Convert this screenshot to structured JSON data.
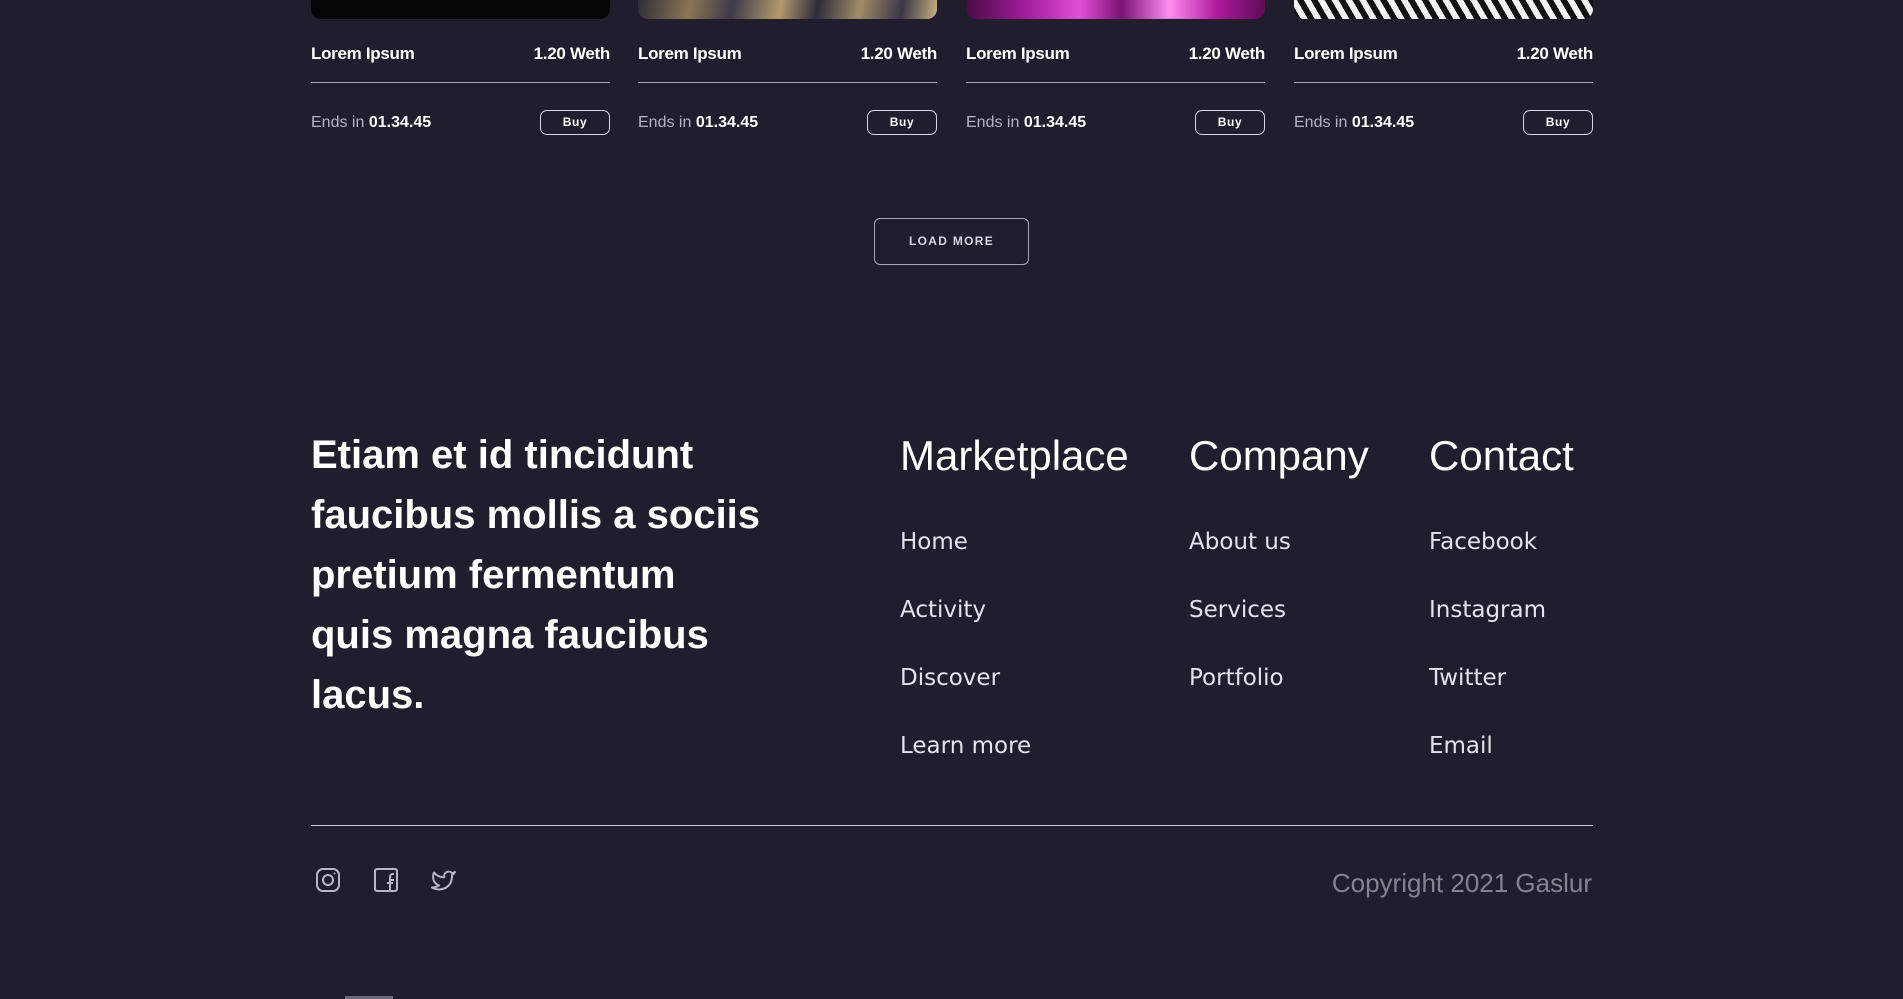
{
  "cards": [
    {
      "title": "Lorem Ipsum",
      "price": "1.20 Weth",
      "ends_label": "Ends in",
      "ends_time": "01.34.45",
      "buy_label": "Buy"
    },
    {
      "title": "Lorem Ipsum",
      "price": "1.20 Weth",
      "ends_label": "Ends in",
      "ends_time": "01.34.45",
      "buy_label": "Buy"
    },
    {
      "title": "Lorem Ipsum",
      "price": "1.20 Weth",
      "ends_label": "Ends in",
      "ends_time": "01.34.45",
      "buy_label": "Buy"
    },
    {
      "title": "Lorem Ipsum",
      "price": "1.20 Weth",
      "ends_label": "Ends in",
      "ends_time": "01.34.45",
      "buy_label": "Buy"
    }
  ],
  "load_more_label": "LOAD MORE",
  "footer": {
    "tagline": "Etiam et id tincidunt faucibus mollis a sociis pretium fermentum quis magna faucibus lacus.",
    "columns": {
      "marketplace": {
        "title": "Marketplace",
        "links": [
          "Home",
          "Activity",
          "Discover",
          "Learn more"
        ]
      },
      "company": {
        "title": "Company",
        "links": [
          "About us",
          "Services",
          "Portfolio"
        ]
      },
      "contact": {
        "title": "Contact",
        "links": [
          "Facebook",
          "Instagram",
          "Twitter",
          "Email"
        ]
      }
    },
    "socials": [
      "instagram-icon",
      "facebook-icon",
      "twitter-icon"
    ],
    "copyright": "Copyright 2021 Gaslur"
  },
  "colors": {
    "background": "#201e2c",
    "text": "#ffffff",
    "muted": "#85838f"
  }
}
